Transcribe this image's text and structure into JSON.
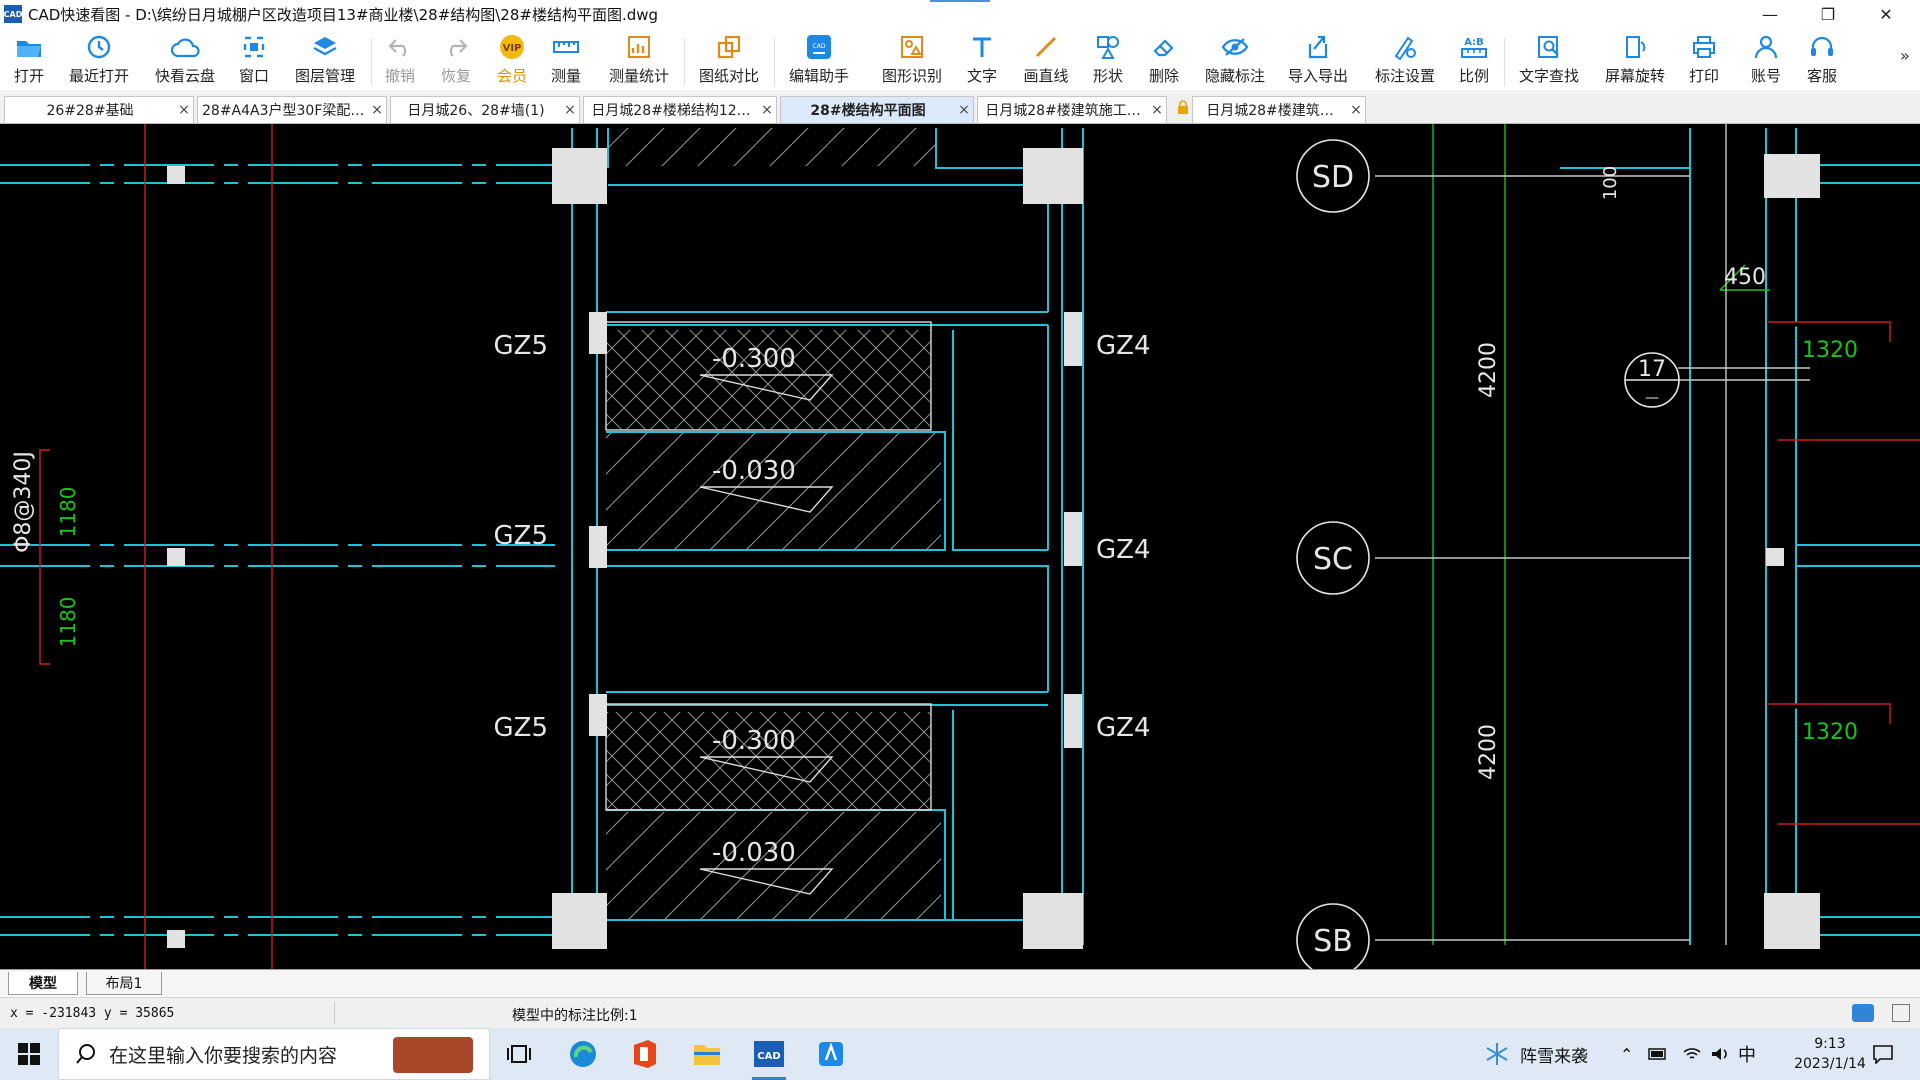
{
  "window": {
    "title": "CAD快速看图 - D:\\缤纷日月城棚户区改造项目13#商业楼\\28#结构图\\28#楼结构平面图.dwg",
    "app_icon_text": "CAD",
    "controls": {
      "minimize": "—",
      "restore": "❐",
      "close": "✕"
    }
  },
  "toolbar": {
    "items": [
      {
        "label": "打开",
        "icon": "folder-open-icon",
        "enabled": true
      },
      {
        "label": "最近打开",
        "icon": "recent-clock-icon",
        "enabled": true
      },
      {
        "label": "快看云盘",
        "icon": "cloud-icon",
        "enabled": true
      },
      {
        "label": "窗口",
        "icon": "window-icon",
        "enabled": true
      },
      {
        "label": "图层管理",
        "icon": "layers-icon",
        "enabled": true
      },
      {
        "label": "撤销",
        "icon": "undo-icon",
        "enabled": false
      },
      {
        "label": "恢复",
        "icon": "redo-icon",
        "enabled": false
      },
      {
        "label": "会员",
        "icon": "vip-badge-icon",
        "enabled": true
      },
      {
        "label": "测量",
        "icon": "ruler-icon",
        "enabled": true
      },
      {
        "label": "测量统计",
        "icon": "measure-stats-icon",
        "enabled": true
      },
      {
        "label": "图纸对比",
        "icon": "compare-icon",
        "enabled": true
      },
      {
        "label": "编辑助手",
        "icon": "edit-helper-icon",
        "enabled": true
      },
      {
        "label": "图形识别",
        "icon": "shape-recognize-icon",
        "enabled": true
      },
      {
        "label": "文字",
        "icon": "text-icon",
        "enabled": true
      },
      {
        "label": "画直线",
        "icon": "line-icon",
        "enabled": true
      },
      {
        "label": "形状",
        "icon": "shapes-icon",
        "enabled": true
      },
      {
        "label": "删除",
        "icon": "eraser-icon",
        "enabled": true
      },
      {
        "label": "隐藏标注",
        "icon": "hide-eye-icon",
        "enabled": true
      },
      {
        "label": "导入导出",
        "icon": "import-export-icon",
        "enabled": true
      },
      {
        "label": "标注设置",
        "icon": "annotation-settings-icon",
        "enabled": true
      },
      {
        "label": "比例",
        "icon": "scale-icon",
        "enabled": true
      },
      {
        "label": "文字查找",
        "icon": "text-search-icon",
        "enabled": true
      },
      {
        "label": "屏幕旋转",
        "icon": "rotate-screen-icon",
        "enabled": true
      },
      {
        "label": "打印",
        "icon": "printer-icon",
        "enabled": true
      },
      {
        "label": "账号",
        "icon": "user-icon",
        "enabled": true
      },
      {
        "label": "客服",
        "icon": "headset-icon",
        "enabled": true
      }
    ],
    "overflow": "»"
  },
  "tabs": [
    {
      "label": "26#28#基础",
      "close": "×",
      "active": false
    },
    {
      "label": "28#A4A3户型30F梁配…",
      "close": "×",
      "active": false
    },
    {
      "label": "日月城26、28#墙(1)",
      "close": "×",
      "active": false
    },
    {
      "label": "日月城28#楼梯结构12…",
      "close": "×",
      "active": false
    },
    {
      "label": "28#楼结构平面图",
      "close": "×",
      "active": true
    },
    {
      "label": "日月城28#楼建筑施工…",
      "close": "×",
      "active": false
    },
    {
      "label": "日月城28#楼建筑…",
      "close": "×",
      "active": false
    }
  ],
  "drawing": {
    "column_labels": [
      "GZ5",
      "GZ4",
      "GZ5",
      "GZ4",
      "GZ5",
      "GZ4"
    ],
    "elevations": [
      "-0.300",
      "-0.030",
      "-0.300",
      "-0.030"
    ],
    "axis_bubbles": [
      "SD",
      "SC",
      "SB"
    ],
    "dims_vertical": [
      "4200",
      "4200",
      "100"
    ],
    "dim_450": "450",
    "dims_green": [
      "1320",
      "1320",
      "1180",
      "1180"
    ],
    "rebar_note": "Φ8@340J",
    "detail_bubble_top": "17",
    "detail_bubble_bottom": "—"
  },
  "layout_tabs": [
    {
      "label": "模型",
      "active": true
    },
    {
      "label": "布局1",
      "active": false
    }
  ],
  "status": {
    "coords": "x = -231843 y = 35865",
    "scale_text": "模型中的标注比例:1"
  },
  "taskbar": {
    "search_placeholder": "在这里输入你要搜索的内容",
    "weather": "阵雪来袭",
    "ime": "中",
    "time": "9:13",
    "date": "2023/1/14"
  }
}
